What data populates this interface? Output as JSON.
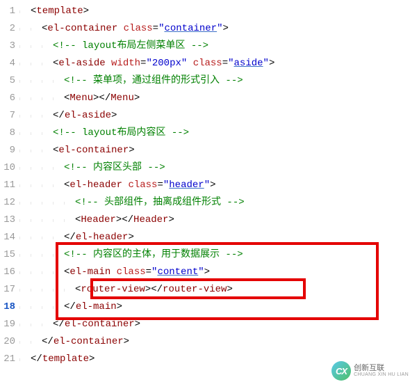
{
  "gutter": [
    "1",
    "2",
    "3",
    "4",
    "5",
    "6",
    "7",
    "8",
    "9",
    "10",
    "11",
    "12",
    "13",
    "14",
    "15",
    "16",
    "17",
    "18",
    "19",
    "20",
    "21"
  ],
  "lines": {
    "l1": {
      "open": "<",
      "tag": "template",
      "close": ">"
    },
    "l2": {
      "open": "<",
      "tag": "el-container",
      "sp": " ",
      "attr": "class",
      "eq": "=",
      "q1": "\"",
      "val": "container",
      "q2": "\"",
      "close": ">"
    },
    "l3": {
      "c1": "<!-- ",
      "c2": "layout",
      "c3": "布局左侧菜单区 -->"
    },
    "l4": {
      "open": "<",
      "tag": "el-aside",
      "sp": " ",
      "attr1": "width",
      "eq1": "=",
      "q1": "\"",
      "val1": "200px",
      "q2": "\"",
      "sp2": " ",
      "attr2": "class",
      "eq2": "=",
      "q3": "\"",
      "val2": "aside",
      "q4": "\"",
      "close": ">"
    },
    "l5": {
      "c1": "<!-- ",
      "c2": "菜单项，通过组件的形式引入 -->"
    },
    "l6": {
      "open": "<",
      "tag": "Menu",
      "close": ">",
      "open2": "</",
      "tag2": "Menu",
      "close2": ">"
    },
    "l7": {
      "open": "</",
      "tag": "el-aside",
      "close": ">"
    },
    "l8": {
      "c1": "<!-- ",
      "c2": "layout",
      "c3": "布局内容区 -->"
    },
    "l9": {
      "open": "<",
      "tag": "el-container",
      "close": ">"
    },
    "l10": {
      "c1": "<!-- ",
      "c2": "内容区头部 -->"
    },
    "l11": {
      "open": "<",
      "tag": "el-header",
      "sp": " ",
      "attr": "class",
      "eq": "=",
      "q1": "\"",
      "val": "header",
      "q2": "\"",
      "close": ">"
    },
    "l12": {
      "c1": "<!-- ",
      "c2": "头部组件，抽离成组件形式 -->"
    },
    "l13": {
      "open": "<",
      "tag": "Header",
      "close": ">",
      "open2": "</",
      "tag2": "Header",
      "close2": ">"
    },
    "l14": {
      "open": "</",
      "tag": "el-header",
      "close": ">"
    },
    "l15": {
      "c1": "<!-- ",
      "c2": "内容区的主体，用于数据展示 -->"
    },
    "l16": {
      "open": "<",
      "tag": "el-main",
      "sp": " ",
      "attr": "class",
      "eq": "=",
      "q1": "\"",
      "val": "content",
      "q2": "\"",
      "close": ">"
    },
    "l17": {
      "open": "<",
      "tag": "router-view",
      "close": ">",
      "open2": "</",
      "tag2": "router-view",
      "close2": ">"
    },
    "l18": {
      "open": "</",
      "tag": "el-main",
      "close": ">"
    },
    "l19": {
      "open": "</",
      "tag": "el-container",
      "close": ">"
    },
    "l20": {
      "open": "</",
      "tag": "el-container",
      "close": ">"
    },
    "l21": {
      "open": "</",
      "tag": "template",
      "close": ">"
    }
  },
  "watermark": {
    "cn": "创新互联",
    "en": "CHUANG XIN HU LIAN"
  }
}
